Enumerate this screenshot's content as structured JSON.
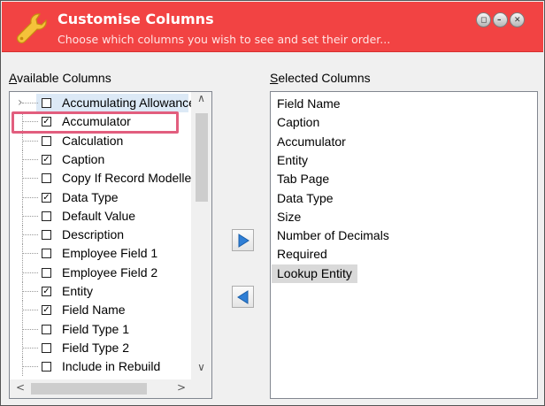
{
  "title": {
    "main": "Customise Columns",
    "subtitle": "Choose which columns you wish to see and set their order..."
  },
  "window_buttons": [
    {
      "name": "restore",
      "glyph": "◻"
    },
    {
      "name": "minimize",
      "glyph": "–"
    },
    {
      "name": "close",
      "glyph": "✕"
    }
  ],
  "available": {
    "label_prefix": "",
    "label_access_key": "A",
    "label_rest": "vailable Columns",
    "items": [
      {
        "label": "Accumulating Allowance",
        "checked": false
      },
      {
        "label": "Accumulator",
        "checked": true
      },
      {
        "label": "Calculation",
        "checked": false
      },
      {
        "label": "Caption",
        "checked": true
      },
      {
        "label": "Copy If Record Modelled",
        "checked": false
      },
      {
        "label": "Data Type",
        "checked": true
      },
      {
        "label": "Default Value",
        "checked": false
      },
      {
        "label": "Description",
        "checked": false
      },
      {
        "label": "Employee Field 1",
        "checked": false
      },
      {
        "label": "Employee Field 2",
        "checked": false
      },
      {
        "label": "Entity",
        "checked": true
      },
      {
        "label": "Field Name",
        "checked": true
      },
      {
        "label": "Field Type 1",
        "checked": false
      },
      {
        "label": "Field Type 2",
        "checked": false
      },
      {
        "label": "Include in Rebuild",
        "checked": false
      }
    ]
  },
  "selected": {
    "label_access_key": "S",
    "label_rest": "elected Columns",
    "items": [
      "Field Name",
      "Caption",
      "Accumulator",
      "Entity",
      "Tab Page",
      "Data Type",
      "Size",
      "Number of Decimals",
      "Required",
      "Lookup Entity"
    ],
    "selected_index": 9
  },
  "colors": {
    "titlebar": "#f24343",
    "highlight": "#e25e7e",
    "arrow": "#2f7fd6"
  }
}
